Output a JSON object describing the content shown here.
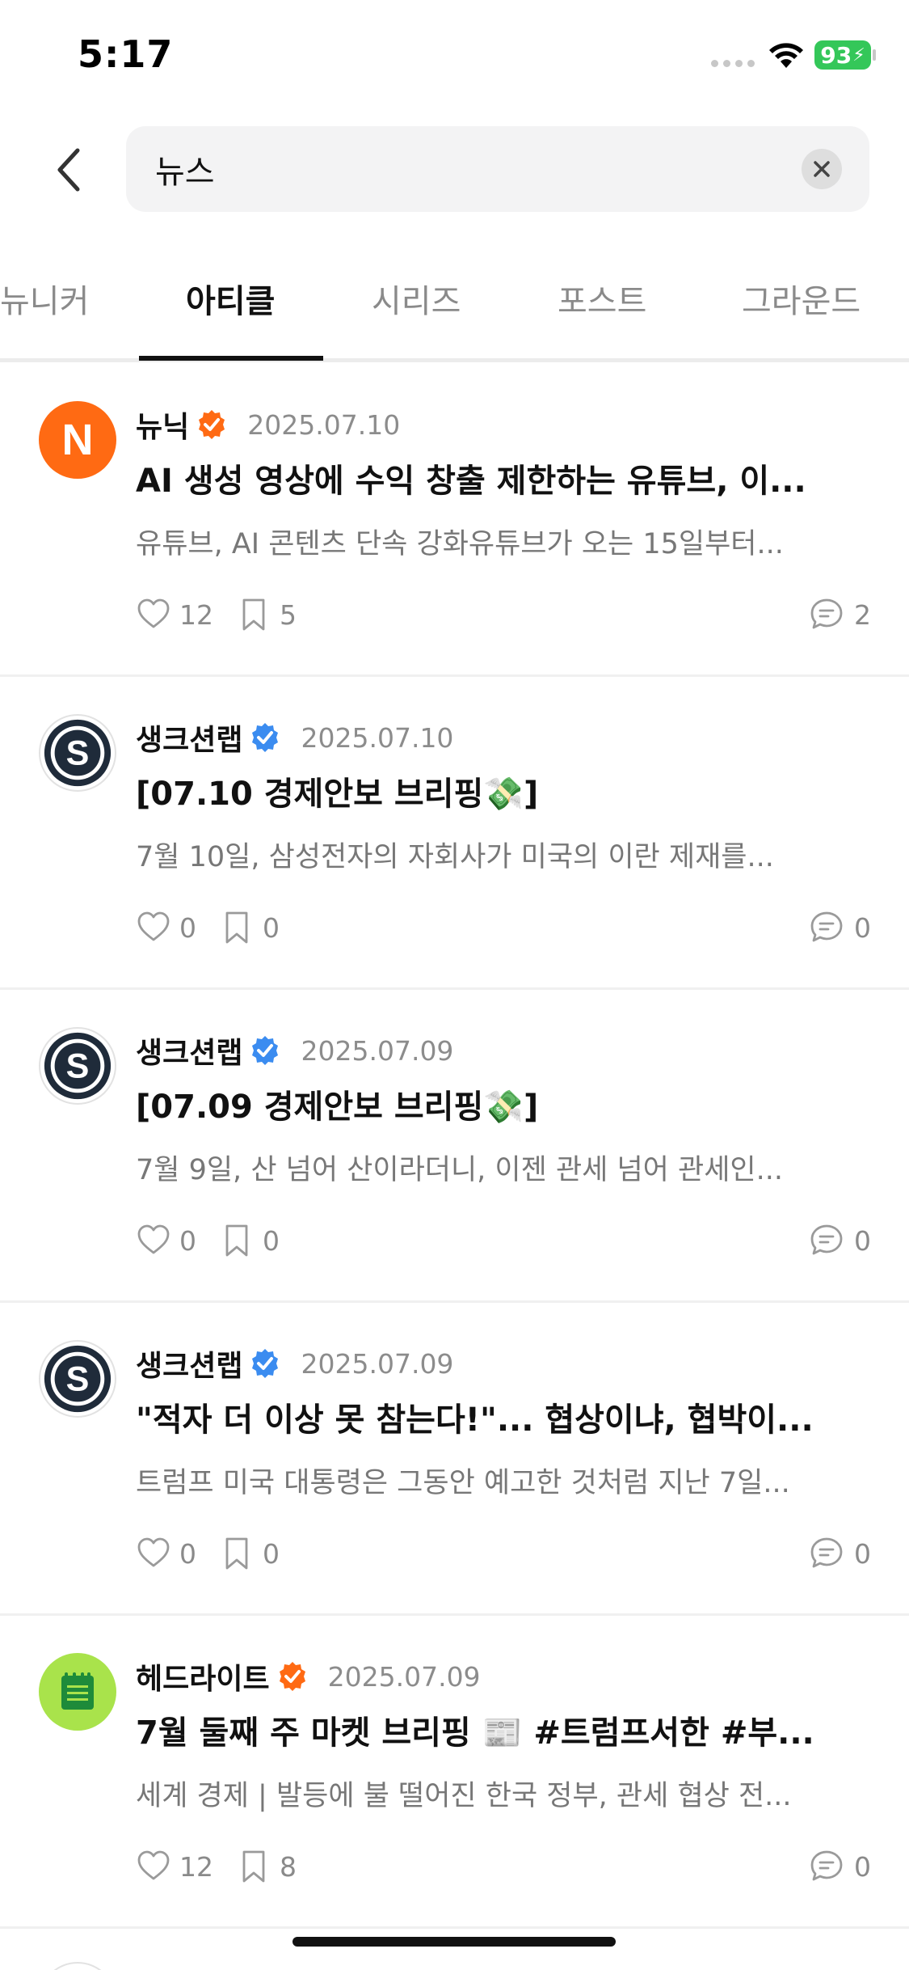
{
  "status_bar": {
    "time": "5:17",
    "battery": "93"
  },
  "search": {
    "query": "뉴스",
    "placeholder": ""
  },
  "tabs": [
    {
      "label": "뉴니커",
      "active": false
    },
    {
      "label": "아티클",
      "active": true
    },
    {
      "label": "시리즈",
      "active": false
    },
    {
      "label": "포스트",
      "active": false
    },
    {
      "label": "그라운드",
      "active": false
    }
  ],
  "posts": [
    {
      "author": "뉴닉",
      "avatar": "N",
      "badge_color": "#ff6a13",
      "date": "2025.07.10",
      "title": "AI 생성 영상에 수익 창출 제한하는 유튜브, 이...",
      "excerpt": "유튜브, AI 콘텐츠 단속 강화유튜브가 오는 15일부터...",
      "likes": "12",
      "bookmarks": "5",
      "comments": "2"
    },
    {
      "author": "생크션랩",
      "avatar": "S",
      "badge_color": "#3b8cf0",
      "date": "2025.07.10",
      "title": "[07.10 경제안보 브리핑💸]",
      "excerpt": "7월 10일, 삼성전자의 자회사가 미국의 이란 제재를...",
      "likes": "0",
      "bookmarks": "0",
      "comments": "0"
    },
    {
      "author": "생크션랩",
      "avatar": "S",
      "badge_color": "#3b8cf0",
      "date": "2025.07.09",
      "title": "[07.09 경제안보 브리핑💸]",
      "excerpt": "7월 9일, 산 넘어 산이라더니, 이젠 관세 넘어 관세인...",
      "likes": "0",
      "bookmarks": "0",
      "comments": "0"
    },
    {
      "author": "생크션랩",
      "avatar": "S",
      "badge_color": "#3b8cf0",
      "date": "2025.07.09",
      "title": "\"적자 더 이상 못 참는다!\"... 협상이냐, 협박이...",
      "excerpt": "트럼프 미국 대통령은 그동안 예고한 것처럼 지난 7일...",
      "likes": "0",
      "bookmarks": "0",
      "comments": "0"
    },
    {
      "author": "헤드라이트",
      "avatar": "notepad",
      "badge_color": "#ff6a13",
      "date": "2025.07.09",
      "title": "7월 둘째 주 마켓 브리핑 📰 #트럼프서한 #부...",
      "excerpt": "세계 경제 | 발등에 불 떨어진 한국 정부, 관세 협상 전...",
      "likes": "12",
      "bookmarks": "8",
      "comments": "0"
    }
  ]
}
